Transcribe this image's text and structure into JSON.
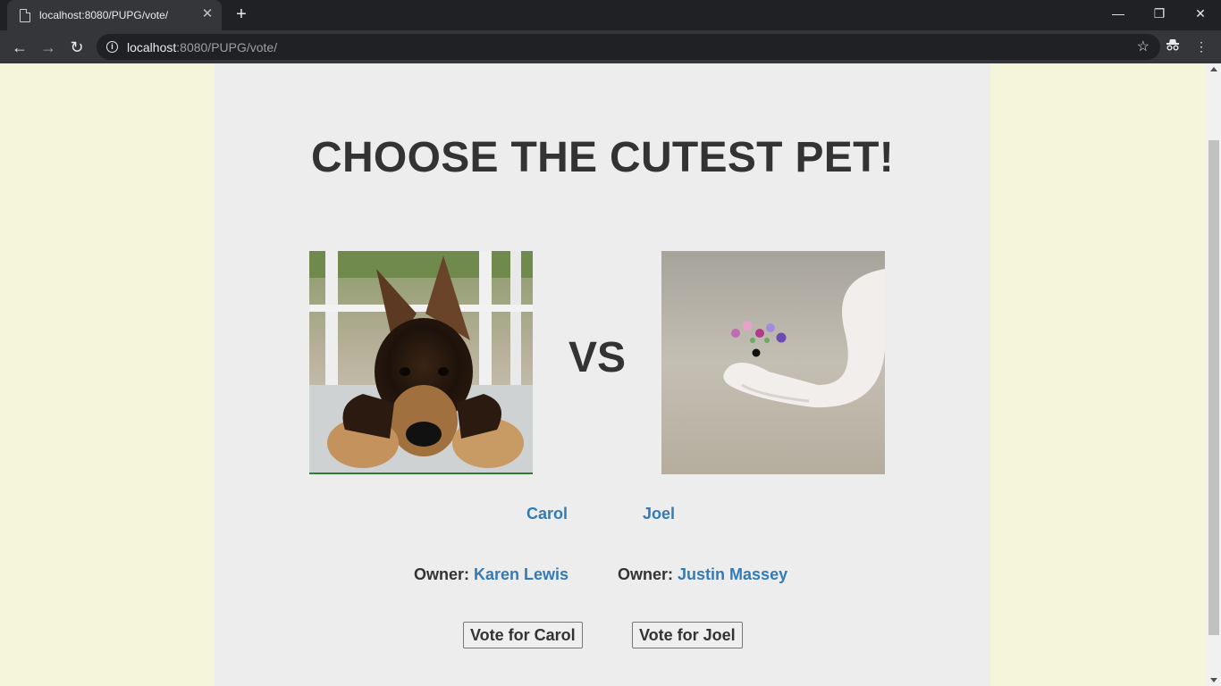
{
  "browser": {
    "tab_title": "localhost:8080/PUPG/vote/",
    "tab_close": "✕",
    "new_tab": "+",
    "url_host": "localhost",
    "url_path": ":8080/PUPG/vote/",
    "controls": {
      "minimize": "—",
      "restore": "❐",
      "close": "✕"
    }
  },
  "page": {
    "heading": "CHOOSE THE CUTEST PET!",
    "vs": "VS",
    "pet_left": {
      "name": "Carol",
      "owner_label": "Owner:",
      "owner_name": "Karen Lewis",
      "vote_label": "Vote for Carol",
      "image_icon": "german-shepherd-puppy"
    },
    "pet_right": {
      "name": "Joel",
      "owner_label": "Owner:",
      "owner_name": "Justin Massey",
      "vote_label": "Vote for Joel",
      "image_icon": "white-snake-flower-crown"
    }
  },
  "colors": {
    "page_bg": "#f5f5dc",
    "container_bg": "#ededed",
    "link": "#337ab7",
    "text": "#333333"
  }
}
